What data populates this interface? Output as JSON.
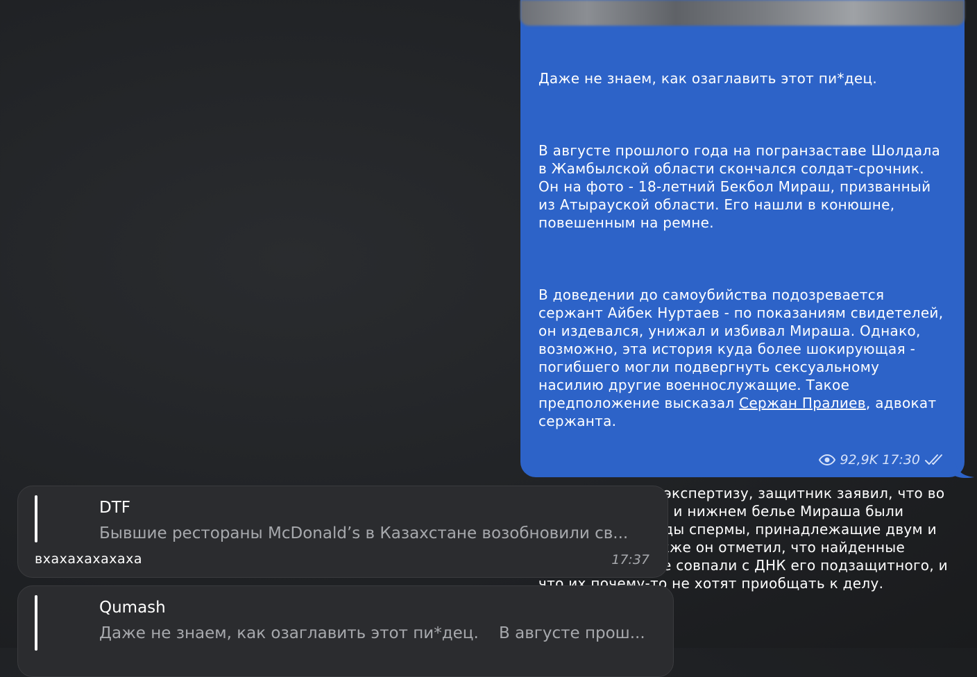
{
  "outgoing_post": {
    "paragraphs": [
      "Даже не знаем, как озаглавить этот пи*дец.",
      "В августе прошлого года на погранзаставе Шолдала в Жамбылской области скончался солдат-срочник. Он на фото - 18-летний Бекбол Мираш, призванный из Атырауской области. Его нашли в конюшне, повешенным на ремне.",
      "В доведении до самоубийства подозревается сержант Айбек Нуртаев - по показаниям свидетелей, он издевался, унижал и избивал Мираша. Однако, возможно, эта история куда более шокирующая - погибшего могли подвергнуть сексуальному насилию другие военнослужащие. Такое предположение высказал ",
      "Ссылаясь на биоэкспертизу, защитник заявил, что во рту, на футболке и нижнем белье Мираша были обнаружены следы спермы, принадлежащие двум и более лицам. Также он отметил, что найденные биоматериалы не совпали с ДНК его подзащитного, и что их почему-то не хотят приобщать к делу."
    ],
    "link_text": "Сержан Пралиев",
    "after_link": ", адвокат сержанта.",
    "views": "92,9K",
    "time": "17:30",
    "read_status_icon": "double-check-icon",
    "views_icon": "eye-icon",
    "bubble_color": "#2d63c8"
  },
  "messages": [
    {
      "reply_name": "DTF",
      "reply_snippet": "Бывшие рестораны McDonald’s в Казахстане возобновили св...",
      "text": "вхахахахахаха",
      "time": "17:37"
    },
    {
      "reply_name": "Qumash",
      "reply_snippet": "Даже не знаем, как озаглавить этот пи*дец.    В августе прош..."
    }
  ]
}
